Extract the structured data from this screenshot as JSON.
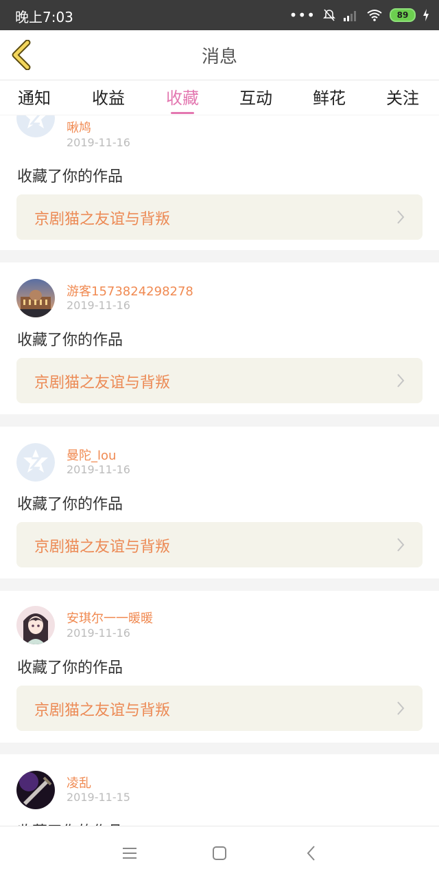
{
  "status": {
    "time": "晚上7:03",
    "battery": "89"
  },
  "header": {
    "title": "消息"
  },
  "tabs": [
    {
      "label": "通知"
    },
    {
      "label": "收益"
    },
    {
      "label": "收藏",
      "active": true
    },
    {
      "label": "互动"
    },
    {
      "label": "鲜花"
    },
    {
      "label": "关注"
    }
  ],
  "items": [
    {
      "user": "啾鸠",
      "date": "2019-11-16",
      "action": "收藏了你的作品",
      "work": "京剧猫之友谊与背叛",
      "avatar": "default-qq-avatar"
    },
    {
      "user": "游客1573824298278",
      "date": "2019-11-16",
      "action": "收藏了你的作品",
      "work": "京剧猫之友谊与背叛",
      "avatar": "photo-building-avatar"
    },
    {
      "user": "曼陀_lou",
      "date": "2019-11-16",
      "action": "收藏了你的作品",
      "work": "京剧猫之友谊与背叛",
      "avatar": "default-qq-avatar"
    },
    {
      "user": "安琪尔一一暖暖",
      "date": "2019-11-16",
      "action": "收藏了你的作品",
      "work": "京剧猫之友谊与背叛",
      "avatar": "anime-girl-avatar"
    },
    {
      "user": "凌乱",
      "date": "2019-11-15",
      "action": "收藏了你的作品",
      "work": "",
      "avatar": "dark-sword-avatar"
    }
  ],
  "colors": {
    "accent": "#e377b0",
    "username": "#f08a52",
    "work_title": "#ec8a55",
    "work_bg": "#f4f3ea"
  }
}
